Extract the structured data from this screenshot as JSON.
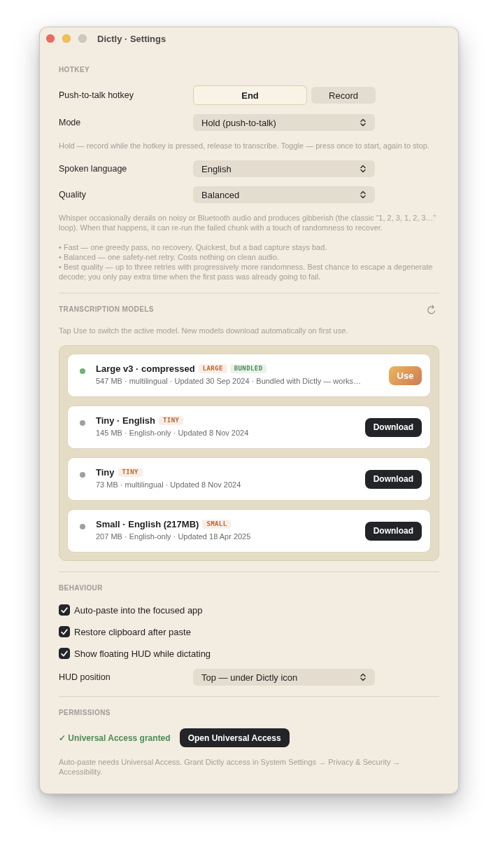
{
  "window": {
    "title": "Dictly · Settings",
    "controls": [
      {
        "kind": "close",
        "disabled": false
      },
      {
        "kind": "minimize",
        "disabled": false
      },
      {
        "kind": "zoom",
        "disabled": true
      }
    ]
  },
  "sections": [
    {
      "heading": "HOTKEY",
      "kind": "settings",
      "items": [
        {
          "kind": "hotkey",
          "label": "Push-to-talk hotkey",
          "value": "End",
          "button": "Record"
        },
        {
          "kind": "select",
          "label": "Mode",
          "value": "Hold (push-to-talk)"
        },
        {
          "kind": "note",
          "text": "Hold — record while the hotkey is pressed, release to transcribe. Toggle — press once to start, again to stop."
        },
        {
          "kind": "select",
          "label": "Spoken language",
          "value": "English"
        },
        {
          "kind": "select",
          "label": "Quality",
          "value": "Balanced"
        },
        {
          "kind": "note",
          "text": "Whisper occasionally derails on noisy or Bluetooth audio and produces gibberish (the classic “1, 2, 3, 1, 2, 3…” loop). When that happens, it can re-run the failed chunk with a touch of randomness to recover.",
          "bullets": [
            "• Fast — one greedy pass, no recovery. Quickest, but a bad capture stays bad.",
            "• Balanced — one safety-net retry. Costs nothing on clean audio.",
            "• Best quality — up to three retries with progressively more randomness. Best chance to escape a degenerate decode; you only pay extra time when the first pass was already going to fail."
          ]
        }
      ]
    },
    {
      "heading": "TRANSCRIPTION MODELS",
      "kind": "models",
      "items": [
        {
          "kind": "note",
          "text": "Tap Use to switch the active model. New models download automatically on first use."
        },
        {
          "kind": "models",
          "models": [
            {
              "title": "Large v3 · compressed",
              "color": "#6cb46f",
              "tags": [
                {
                  "label": "LARGE",
                  "color": "#c0652f"
                },
                {
                  "label": "BUNDLED",
                  "color": "#4d8a55"
                }
              ],
              "details": "547 MB · multilingual · Updated 30 Sep 2024 · Bundled with Dictly — works…",
              "action": {
                "kind": "use",
                "label": "Use"
              }
            },
            {
              "title": "Tiny · English",
              "color": "#9e9ea3",
              "tags": [
                {
                  "label": "TINY",
                  "color": "#c0652f"
                }
              ],
              "details": "145 MB · English-only · Updated 8 Nov 2024",
              "action": {
                "kind": "download",
                "label": "Download"
              }
            },
            {
              "title": "Tiny",
              "color": "#9e9ea3",
              "tags": [
                {
                  "label": "TINY",
                  "color": "#c0652f"
                }
              ],
              "details": "73 MB · multilingual · Updated 8 Nov 2024",
              "action": {
                "kind": "download",
                "label": "Download"
              }
            },
            {
              "title": "Small · English (217MB)",
              "color": "#9e9ea3",
              "tags": [
                {
                  "label": "SMALL",
                  "color": "#c0652f"
                }
              ],
              "details": "207 MB · English-only · Updated 18 Apr 2025",
              "action": {
                "kind": "download",
                "label": "Download"
              }
            }
          ]
        }
      ]
    },
    {
      "heading": "BEHAVIOUR",
      "kind": "settings",
      "items": [
        {
          "kind": "checkbox",
          "label": "Auto-paste into the focused app",
          "checked": true
        },
        {
          "kind": "checkbox",
          "label": "Restore clipboard after paste",
          "checked": true
        },
        {
          "kind": "checkbox",
          "label": "Show floating HUD while dictating",
          "checked": true
        },
        {
          "kind": "select",
          "label": "HUD position",
          "value": "Top — under Dictly icon"
        }
      ]
    },
    {
      "heading": "PERMISSIONS",
      "kind": "settings",
      "items": [
        {
          "kind": "permission",
          "status": "✓ Universal Access granted",
          "granted": true,
          "button": "Open Universal Access"
        },
        {
          "kind": "note",
          "text": "Auto-paste needs Universal Access. Grant Dictly access in System Settings → Privacy & Security → Accessibility."
        }
      ]
    }
  ]
}
